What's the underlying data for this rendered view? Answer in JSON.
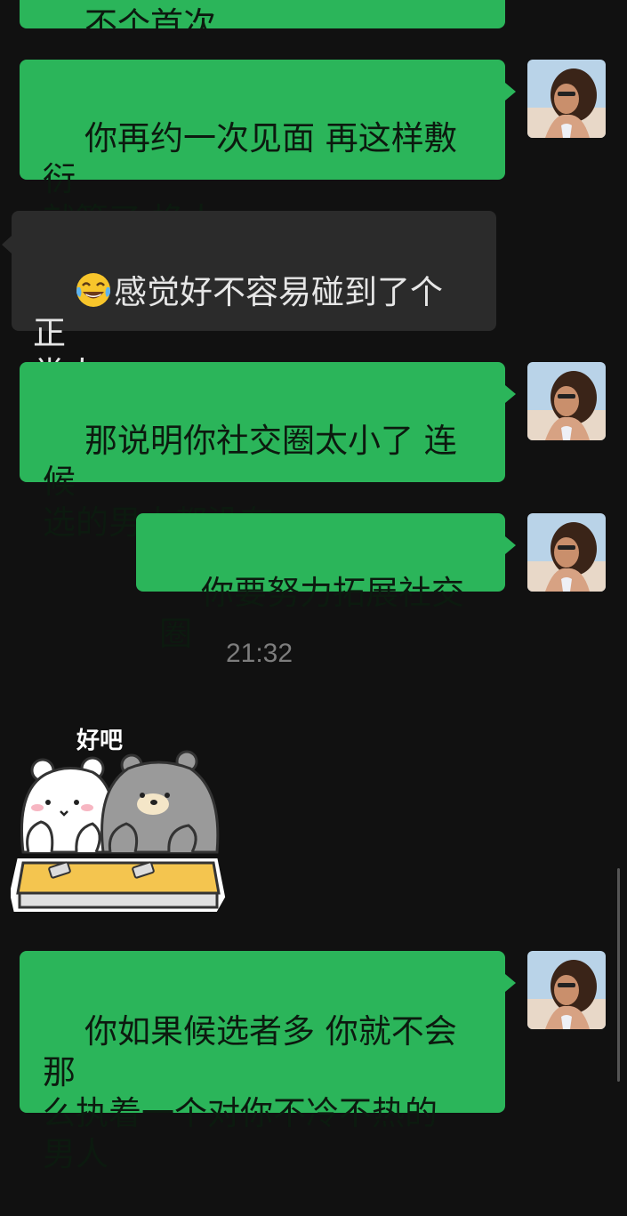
{
  "messages": [
    {
      "id": "m0",
      "side": "out",
      "text": "不个首次"
    },
    {
      "id": "m1",
      "side": "out",
      "text": "你再约一次见面 再这样敷衍\n就算了 换人"
    },
    {
      "id": "m2",
      "side": "in",
      "emoji": "face-with-tears-of-joy",
      "text": "感觉好不容易碰到了个正\n常人"
    },
    {
      "id": "m3",
      "side": "out",
      "text": "那说明你社交圈太小了 连候\n选的男人都没有"
    },
    {
      "id": "m4",
      "side": "out",
      "text": "你要努力拓展社交圈"
    },
    {
      "id": "m5",
      "side": "out",
      "text": "你如果候选者多 你就不会那\n么执着一个对你不冷不热的\n男人"
    }
  ],
  "timestamp": "21:32",
  "sticker": {
    "caption": "好吧",
    "icon": "two-bears-sticker"
  },
  "colors": {
    "background": "#111111",
    "outgoing_bubble": "#2bb55a",
    "incoming_bubble": "#2b2b2b",
    "timestamp": "#7d7d7d"
  }
}
